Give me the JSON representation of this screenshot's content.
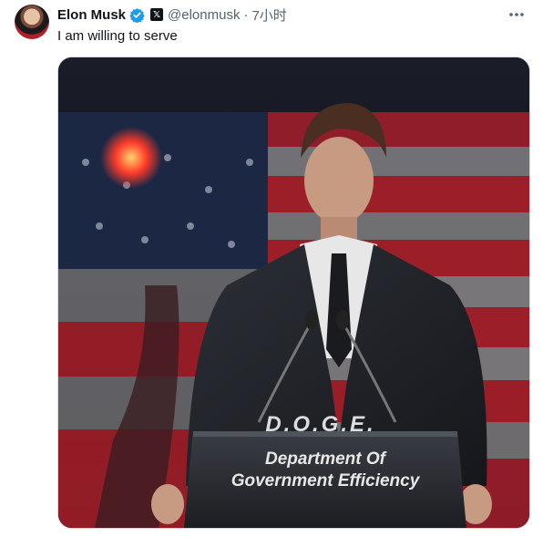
{
  "tweet": {
    "author_name": "Elon Musk",
    "handle": "@elonmusk",
    "separator": "·",
    "time": "7小时",
    "text": "I am willing to serve",
    "more_icon": "more-horizontal-icon",
    "verified_icon": "verified-badge-icon",
    "affiliate_icon": "x-logo-icon"
  },
  "image": {
    "podium_top": "D.O.G.E.",
    "podium_line1": "Department Of",
    "podium_line2": "Government Efficiency"
  },
  "colors": {
    "verified_blue": "#1d9bf0",
    "flag_red": "#b3202a",
    "secondary_text": "#536471"
  }
}
